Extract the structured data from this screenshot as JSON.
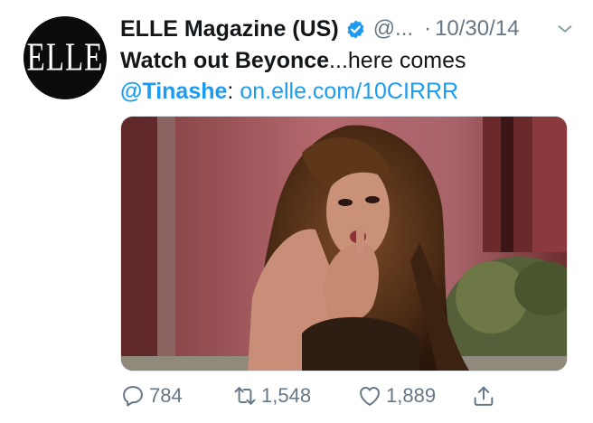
{
  "avatar": {
    "logo_text": "ELLE"
  },
  "header": {
    "name": "ELLE Magazine (US)",
    "handle": "@...",
    "separator": "·",
    "date": "10/30/14"
  },
  "tweet": {
    "text_bold": "Watch out Beyonce",
    "text_rest": "...here comes",
    "mention": "@Tinashe",
    "colon": ":",
    "link": "on.elle.com/10CIRRR"
  },
  "actions": {
    "replies": "784",
    "retweets": "1,548",
    "likes": "1,889"
  },
  "icons": [
    "verified-badge-icon",
    "chevron-down-icon",
    "reply-icon",
    "retweet-icon",
    "like-icon",
    "share-icon"
  ],
  "colors": {
    "link": "#1d9bf0",
    "secondary_text": "#657786",
    "primary_text": "#14171a"
  }
}
